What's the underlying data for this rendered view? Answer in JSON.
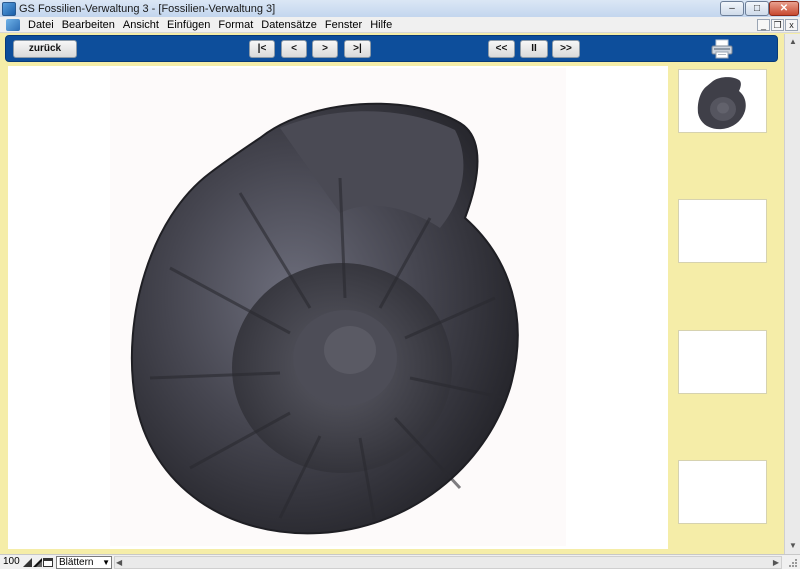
{
  "window": {
    "title": "GS Fossilien-Verwaltung 3 - [Fossilien-Verwaltung 3]",
    "controls": {
      "minimize": "–",
      "maximize": "□",
      "close": "✕"
    }
  },
  "menu": {
    "items": [
      "Datei",
      "Bearbeiten",
      "Ansicht",
      "Einfügen",
      "Format",
      "Datensätze",
      "Fenster",
      "Hilfe"
    ],
    "mdi_controls": {
      "minimize": "_",
      "restore": "❐",
      "close": "x"
    }
  },
  "toolbar": {
    "back_label": "zurück",
    "first_label": "|<",
    "prev_label": "<",
    "next_label": ">",
    "last_label": ">|",
    "rewind_label": "<<",
    "pause_label": "II",
    "forward_label": ">>",
    "print_icon": "printer-icon",
    "background_color": "#0d4e9b"
  },
  "viewer": {
    "image_subject": "ammonite-fossil",
    "thumbnails": [
      {
        "has_image": true
      },
      {
        "has_image": false
      },
      {
        "has_image": false
      },
      {
        "has_image": false
      }
    ]
  },
  "statusbar": {
    "zoom": "100",
    "view_mode": "Blättern"
  },
  "colors": {
    "sidebar_background": "#f5eda8",
    "toolbar": "#0d4e9b"
  }
}
